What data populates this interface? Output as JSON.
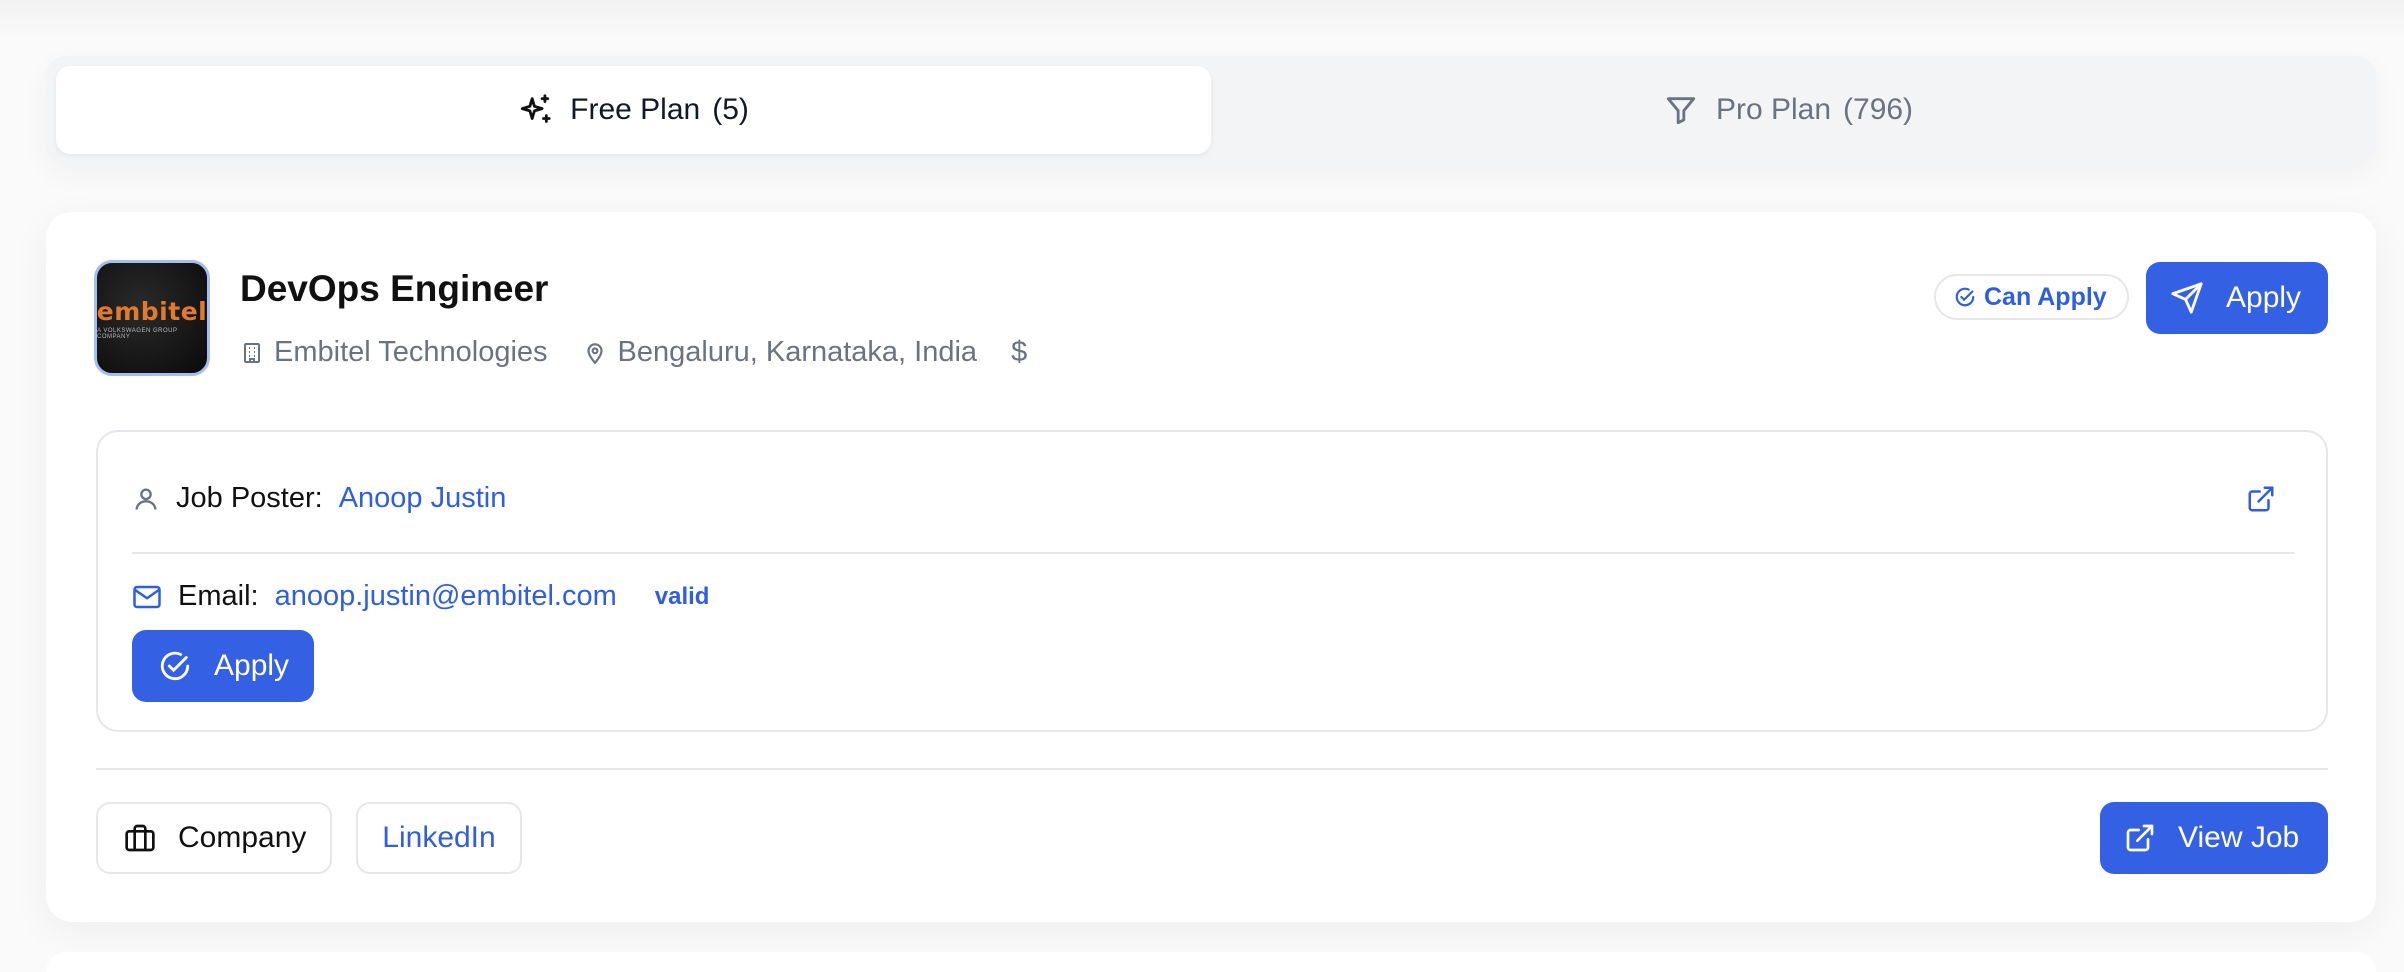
{
  "tabs": {
    "free": {
      "label": "Free Plan",
      "count": "(5)",
      "icon": "sparkles-icon"
    },
    "pro": {
      "label": "Pro Plan",
      "count": "(796)",
      "icon": "filter-icon"
    }
  },
  "job": {
    "logo_text": "embitel",
    "logo_subtext": "A VOLKSWAGEN GROUP COMPANY",
    "title": "DevOps Engineer",
    "company": "Embitel Technologies",
    "location": "Bengaluru, Karnataka, India",
    "salary_icon": "$",
    "status_badge": "Can Apply",
    "apply_label": "Apply"
  },
  "poster": {
    "label": "Job Poster:",
    "name": "Anoop Justin",
    "email_label": "Email:",
    "email": "anoop.justin@embitel.com",
    "email_status": "valid",
    "apply_label": "Apply"
  },
  "footer": {
    "company_label": "Company",
    "linkedin_label": "LinkedIn",
    "view_job_label": "View Job"
  },
  "colors": {
    "accent": "#3461e4",
    "link": "#2f5fe0",
    "muted": "#6b7280",
    "border": "#e5e7eb"
  }
}
